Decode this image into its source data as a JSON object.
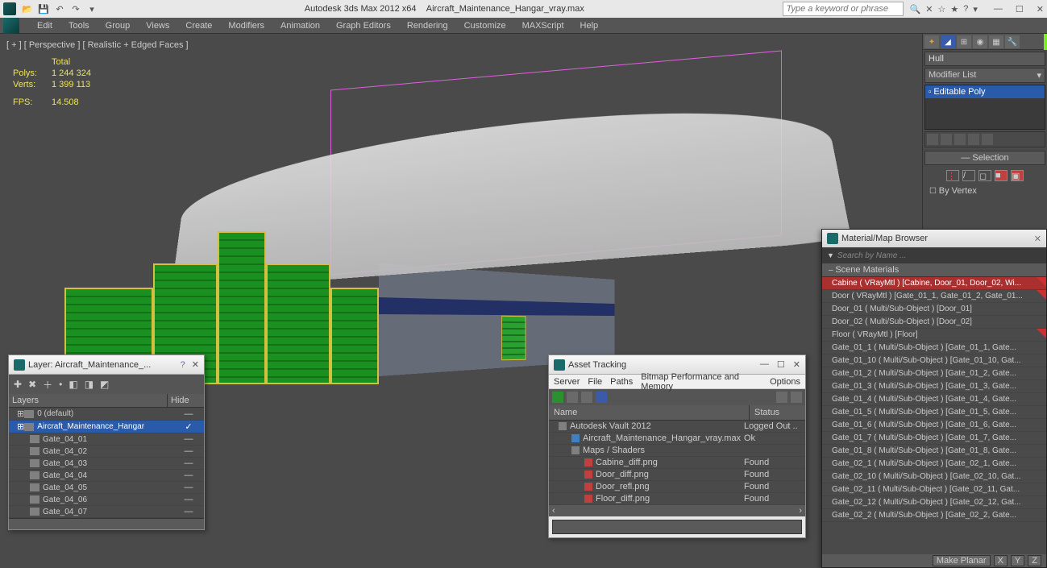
{
  "titlebar": {
    "app": "Autodesk 3ds Max  2012 x64",
    "file": "Aircraft_Maintenance_Hangar_vray.max",
    "search_placeholder": "Type a keyword or phrase"
  },
  "menubar": [
    "Edit",
    "Tools",
    "Group",
    "Views",
    "Create",
    "Modifiers",
    "Animation",
    "Graph Editors",
    "Rendering",
    "Customize",
    "MAXScript",
    "Help"
  ],
  "viewport": {
    "label": "[ + ] [ Perspective ] [ Realistic + Edged Faces ]",
    "stats_header": "Total",
    "polys_label": "Polys:",
    "polys": "1 244 324",
    "verts_label": "Verts:",
    "verts": "1 399 113",
    "fps_label": "FPS:",
    "fps": "14.508"
  },
  "cmd": {
    "object_name": "Hull",
    "modlist_label": "Modifier List",
    "stack_item": "Editable Poly",
    "selection_title": "Selection",
    "by_vertex": "By Vertex"
  },
  "layer_panel": {
    "title": "Layer: Aircraft_Maintenance_...",
    "col_layers": "Layers",
    "col_hide": "Hide",
    "rows": [
      {
        "name": "0 (default)",
        "indent": 0,
        "sel": false
      },
      {
        "name": "Aircraft_Maintenance_Hangar",
        "indent": 0,
        "sel": true
      },
      {
        "name": "Gate_04_01",
        "indent": 1,
        "sel": false
      },
      {
        "name": "Gate_04_02",
        "indent": 1,
        "sel": false
      },
      {
        "name": "Gate_04_03",
        "indent": 1,
        "sel": false
      },
      {
        "name": "Gate_04_04",
        "indent": 1,
        "sel": false
      },
      {
        "name": "Gate_04_05",
        "indent": 1,
        "sel": false
      },
      {
        "name": "Gate_04_06",
        "indent": 1,
        "sel": false
      },
      {
        "name": "Gate_04_07",
        "indent": 1,
        "sel": false
      }
    ]
  },
  "asset_panel": {
    "title": "Asset Tracking",
    "menu": [
      "Server",
      "File",
      "Paths",
      "Bitmap Performance and Memory",
      "Options"
    ],
    "col_name": "Name",
    "col_status": "Status",
    "rows": [
      {
        "name": "Autodesk Vault 2012",
        "status": "Logged Out ..",
        "ico": "fold",
        "indent": 0
      },
      {
        "name": "Aircraft_Maintenance_Hangar_vray.max",
        "status": "Ok",
        "ico": "scene",
        "indent": 1
      },
      {
        "name": "Maps / Shaders",
        "status": "",
        "ico": "fold",
        "indent": 1
      },
      {
        "name": "Cabine_diff.png",
        "status": "Found",
        "ico": "png",
        "indent": 2
      },
      {
        "name": "Door_diff.png",
        "status": "Found",
        "ico": "png",
        "indent": 2
      },
      {
        "name": "Door_refl.png",
        "status": "Found",
        "ico": "png",
        "indent": 2
      },
      {
        "name": "Floor_diff.png",
        "status": "Found",
        "ico": "png",
        "indent": 2
      }
    ]
  },
  "mat_panel": {
    "title": "Material/Map Browser",
    "search": "Search by Name ...",
    "section": "Scene Materials",
    "rows": [
      {
        "t": "Cabine ( VRayMtl ) [Cabine, Door_01, Door_02, Wi...",
        "sel": true,
        "mark": true
      },
      {
        "t": "Door ( VRayMtl ) [Gate_01_1, Gate_01_2, Gate_01...",
        "mark": true
      },
      {
        "t": "Door_01 ( Multi/Sub-Object ) [Door_01]"
      },
      {
        "t": "Door_02 ( Multi/Sub-Object ) [Door_02]"
      },
      {
        "t": "Floor ( VRayMtl ) [Floor]",
        "mark": true
      },
      {
        "t": "Gate_01_1 ( Multi/Sub-Object ) [Gate_01_1, Gate..."
      },
      {
        "t": "Gate_01_10 ( Multi/Sub-Object ) [Gate_01_10, Gat..."
      },
      {
        "t": "Gate_01_2 ( Multi/Sub-Object ) [Gate_01_2, Gate..."
      },
      {
        "t": "Gate_01_3 ( Multi/Sub-Object ) [Gate_01_3, Gate..."
      },
      {
        "t": "Gate_01_4 ( Multi/Sub-Object ) [Gate_01_4, Gate..."
      },
      {
        "t": "Gate_01_5 ( Multi/Sub-Object ) [Gate_01_5, Gate..."
      },
      {
        "t": "Gate_01_6 ( Multi/Sub-Object ) [Gate_01_6, Gate..."
      },
      {
        "t": "Gate_01_7 ( Multi/Sub-Object ) [Gate_01_7, Gate..."
      },
      {
        "t": "Gate_01_8 ( Multi/Sub-Object ) [Gate_01_8, Gate..."
      },
      {
        "t": "Gate_02_1 ( Multi/Sub-Object ) [Gate_02_1, Gate..."
      },
      {
        "t": "Gate_02_10 ( Multi/Sub-Object ) [Gate_02_10, Gat..."
      },
      {
        "t": "Gate_02_11 ( Multi/Sub-Object ) [Gate_02_11, Gat..."
      },
      {
        "t": "Gate_02_12 ( Multi/Sub-Object ) [Gate_02_12, Gat..."
      },
      {
        "t": "Gate_02_2 ( Multi/Sub-Object ) [Gate_02_2, Gate..."
      }
    ]
  },
  "bottom": {
    "make_planar": "Make Planar",
    "x": "X",
    "y": "Y",
    "z": "Z"
  }
}
